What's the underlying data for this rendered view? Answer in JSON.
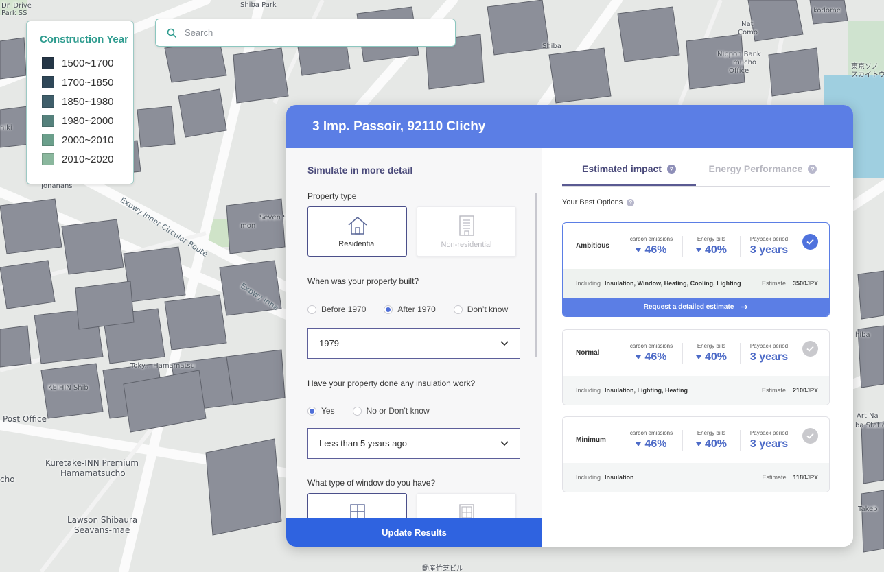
{
  "map_labels": {
    "drive": "Dr. Drive",
    "park_ss": "Park SS",
    "shiba_park": "Shiba Park",
    "shiba": "Shiba",
    "kodome": "kodome",
    "nat": "Nat",
    "como": "Como",
    "nippon_bank": "Nippon Bank",
    "mucho": "mucho",
    "office": "Office",
    "tokyo_jp": "東京ソノ",
    "skytower_jp": "スカイトウ",
    "niki": "niki",
    "johnans": "Johanans",
    "expwy_inner_circular": "Expwy Inner Circular Route",
    "expwy_inne": "Expwy Inne",
    "seven_s": "Seven S",
    "mon": "mon",
    "tokyo_hamamatsu": "Toky... Hamamatsu",
    "keihin_shib": "KEIHIN Shib",
    "post_office": "Post Office",
    "kuretake": "Kuretake-INN Premium",
    "hamamatsucho": "Hamamatsucho",
    "cho": "cho",
    "lawson_shibaura": "Lawson Shibaura",
    "seavans_mae": "Seavans-mae",
    "shiba_right": "hiba",
    "art_n": "Art Na",
    "ba_station": "ba Station",
    "takeb": "Takeb",
    "shiba_bld_jp": "動産竹芝ビル"
  },
  "legend": {
    "title": "Construction Year",
    "items": [
      {
        "label": "1500~1700",
        "color": "#253646"
      },
      {
        "label": "1700~1850",
        "color": "#2f4758"
      },
      {
        "label": "1850~1980",
        "color": "#3f5e6a"
      },
      {
        "label": "1980~2000",
        "color": "#55817c"
      },
      {
        "label": "2000~2010",
        "color": "#6b9f8b"
      },
      {
        "label": "2010~2020",
        "color": "#8ab79d"
      }
    ]
  },
  "search": {
    "placeholder": "Search"
  },
  "panel": {
    "address": "3 Imp. Passoir, 92110 Clichy",
    "left": {
      "section_title": "Simulate in more detail",
      "property_type_label": "Property type",
      "property_types": [
        {
          "label": "Residential",
          "selected": true
        },
        {
          "label": "Non-residential",
          "selected": false
        }
      ],
      "built_question": "When was your property built?",
      "built_options": [
        {
          "label": "Before 1970",
          "selected": false
        },
        {
          "label": "After 1970",
          "selected": true
        },
        {
          "label": "Don’t know",
          "selected": false
        }
      ],
      "built_year": "1979",
      "insulation_question": "Have your property done any insulation work?",
      "insulation_options": [
        {
          "label": "Yes",
          "selected": true
        },
        {
          "label": "No or Don’t know",
          "selected": false
        }
      ],
      "insulation_when": "Less than 5 years ago",
      "window_question": "What type of window do you have?",
      "update_button": "Update Results"
    },
    "right": {
      "tabs": [
        {
          "label": "Estimated impact",
          "active": true
        },
        {
          "label": "Energy Performance",
          "active": false
        }
      ],
      "best_options_label": "Your Best Options",
      "metric_labels": {
        "carbon": "carbon emissions",
        "bills": "Energy bills",
        "payback": "Payback period"
      },
      "including_label": "Including",
      "estimate_label": "Estimate",
      "options": [
        {
          "name": "Ambitious",
          "carbon": "46%",
          "bills": "40%",
          "payback": "3 years",
          "including": "Insulation, Window, Heating, Cooling, Lighting",
          "estimate": "3500JPY",
          "selected": true,
          "cta": "Request a detailed estimate"
        },
        {
          "name": "Normal",
          "carbon": "46%",
          "bills": "40%",
          "payback": "3 years",
          "including": "Insulation, Lighting, Heating",
          "estimate": "2100JPY",
          "selected": false
        },
        {
          "name": "Minimum",
          "carbon": "46%",
          "bills": "40%",
          "payback": "3 years",
          "including": "Insulation",
          "estimate": "1180JPY",
          "selected": false
        }
      ]
    }
  }
}
